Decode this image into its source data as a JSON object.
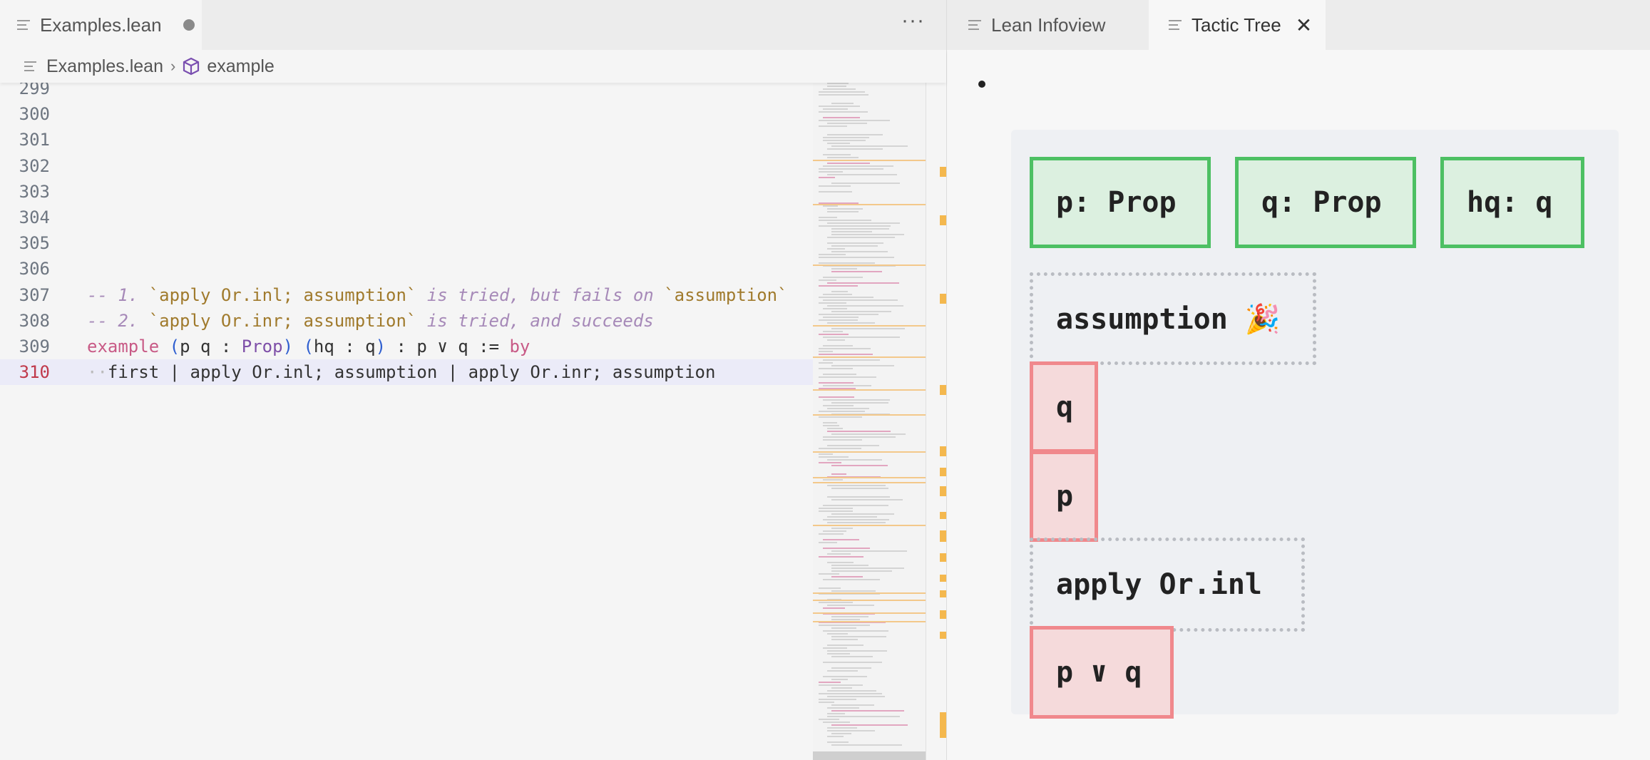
{
  "editor": {
    "tab": {
      "file_name": "Examples.lean",
      "more_label": "···"
    },
    "breadcrumb": {
      "file": "Examples.lean",
      "separator": "›",
      "symbol": "example"
    },
    "lines": [
      {
        "num": "299",
        "segments": []
      },
      {
        "num": "300",
        "segments": []
      },
      {
        "num": "301",
        "segments": []
      },
      {
        "num": "302",
        "segments": []
      },
      {
        "num": "303",
        "segments": []
      },
      {
        "num": "304",
        "segments": []
      },
      {
        "num": "305",
        "segments": []
      },
      {
        "num": "306",
        "segments": []
      },
      {
        "num": "307",
        "segments": [
          {
            "t": "-- 1. ",
            "c": "cm"
          },
          {
            "t": "`apply Or.inl; assumption`",
            "c": "bt"
          },
          {
            "t": " is tried, but fails on ",
            "c": "cm"
          },
          {
            "t": "`assumption`",
            "c": "bt"
          }
        ]
      },
      {
        "num": "308",
        "segments": [
          {
            "t": "-- 2. ",
            "c": "cm"
          },
          {
            "t": "`apply Or.inr; assumption`",
            "c": "bt"
          },
          {
            "t": " is tried, and succeeds",
            "c": "cm"
          }
        ]
      },
      {
        "num": "309",
        "segments": [
          {
            "t": "example",
            "c": "kw"
          },
          {
            "t": " ",
            "c": ""
          },
          {
            "t": "(",
            "c": "paren"
          },
          {
            "t": "p q : ",
            "c": ""
          },
          {
            "t": "Prop",
            "c": "ty"
          },
          {
            "t": ")",
            "c": "paren"
          },
          {
            "t": " ",
            "c": ""
          },
          {
            "t": "(",
            "c": "paren"
          },
          {
            "t": "hq : q",
            "c": ""
          },
          {
            "t": ")",
            "c": "paren"
          },
          {
            "t": " : p ∨ q := ",
            "c": ""
          },
          {
            "t": "by",
            "c": "kw"
          }
        ]
      },
      {
        "num": "310",
        "current": true,
        "segments": [
          {
            "t": "··",
            "c": "ws"
          },
          {
            "t": "first | apply Or.inl; assumption | apply Or.inr; assumption",
            "c": ""
          }
        ]
      }
    ]
  },
  "infoview": {
    "tabs": [
      {
        "label": "Lean Infoview"
      },
      {
        "label": "Tactic Tree",
        "active": true,
        "close": "✕"
      }
    ],
    "tree": {
      "hypotheses": [
        "p: Prop",
        "q: Prop",
        "hq: q"
      ],
      "tactic_assumption": "assumption 🎉",
      "goal_q": "q",
      "goal_p": "p",
      "tactic_apply": "apply Or.inl",
      "goal_or": "p ∨ q"
    }
  },
  "colors": {
    "hyp_border": "#4dc063",
    "hyp_fill": "#dcf0e0",
    "goal_border": "#f0888c",
    "goal_fill": "#f5dadb",
    "line_number_current": "#c0394b"
  },
  "icons": [
    "file-lines-icon",
    "cube-icon",
    "more-actions-icon",
    "close-icon",
    "bullet-icon"
  ]
}
